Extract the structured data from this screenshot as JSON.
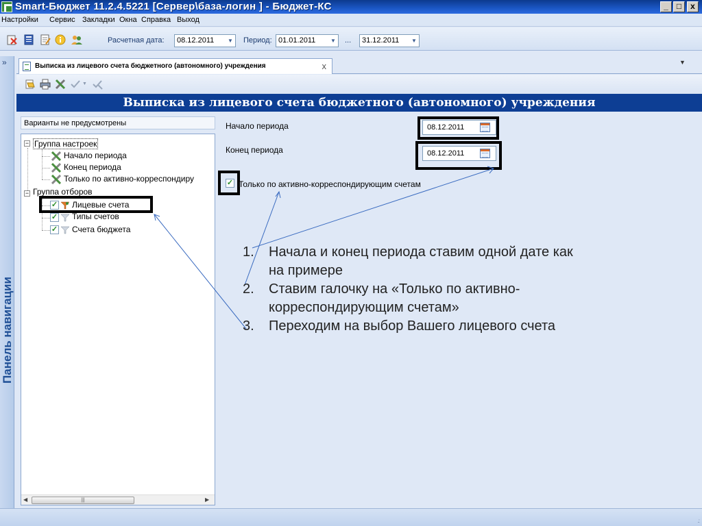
{
  "window": {
    "title": "Smart-Бюджет 11.2.4.5221 [Сервер\\база-логин    ] - Бюджет-КС",
    "min_label": "_",
    "max_label": "□",
    "close_label": "x"
  },
  "menu": {
    "items": [
      "Настройки",
      "Сервис",
      "Закладки",
      "Окна",
      "Справка",
      "Выход"
    ]
  },
  "toolbar": {
    "calc_date_label": "Расчетная дата:",
    "calc_date_value": "08.12.2011",
    "period_label": "Период:",
    "period_from": "01.01.2011",
    "period_separator": "...",
    "period_to": "31.12.2011"
  },
  "nav_panel": {
    "title": "Панель навигации",
    "collapse_icon": "»",
    "expand_icon": "»"
  },
  "tab": {
    "label": "Выписка из лицевого счета бюджетного (автономного) учреждения",
    "close": "x"
  },
  "form": {
    "header": "Выписка из лицевого счета бюджетного (автономного) учреждения",
    "variants": "Варианты не предусмотрены",
    "tree": {
      "group_settings": "Группа настроек",
      "settings_items": [
        "Начало периода",
        "Конец периода",
        "Только по активно-корреспондиру"
      ],
      "group_filters": "Группа отборов",
      "filter_items": [
        "Лицевые счета",
        "Типы счетов",
        "Счета бюджета"
      ]
    },
    "start_label": "Начало периода",
    "start_value": "08.12.2011",
    "end_label": "Конец периода",
    "end_value": "08.12.2011",
    "checkbox_label": "Только по активно-корреспондирующим счетам",
    "checkbox_checked": true
  },
  "annotation": {
    "steps": [
      {
        "num": "1.",
        "text": "Начала и конец периода ставим одной дате как на примере"
      },
      {
        "num": "2.",
        "text": "Ставим галочку на «Только по активно-корреспондирующим счетам»"
      },
      {
        "num": "3.",
        "text": "Переходим на выбор Вашего лицевого счета"
      }
    ]
  }
}
